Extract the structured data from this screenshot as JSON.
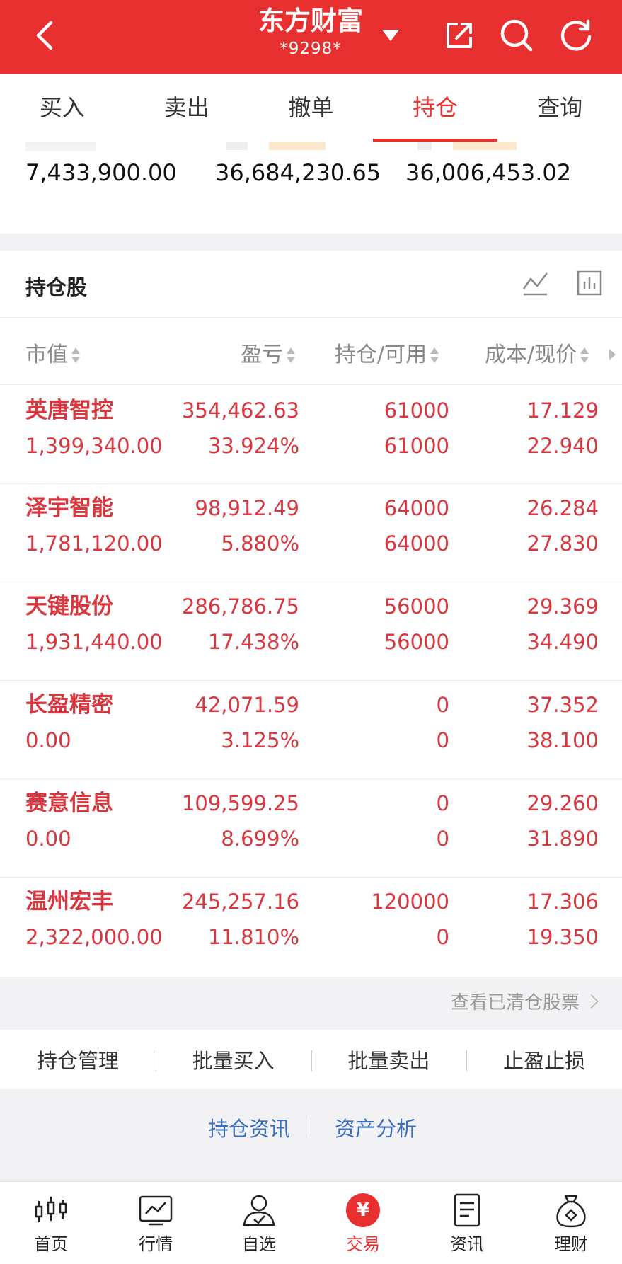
{
  "header": {
    "title": "东方财富",
    "account": "*9298*",
    "colors": {
      "primary": "#e93030",
      "profit": "#d9363e",
      "link": "#3a6ec0"
    }
  },
  "tabs": [
    {
      "label": "买入",
      "active": false
    },
    {
      "label": "卖出",
      "active": false
    },
    {
      "label": "撤单",
      "active": false
    },
    {
      "label": "持仓",
      "active": true
    },
    {
      "label": "查询",
      "active": false
    }
  ],
  "summary": {
    "values": [
      "7,433,900.00",
      "36,684,230.65",
      "36,006,453.02"
    ]
  },
  "holdings": {
    "title": "持仓股",
    "columns": [
      "市值",
      "盈亏",
      "持仓/可用",
      "成本/现价"
    ],
    "rows": [
      {
        "name": "英唐智控",
        "market_value": "1,399,340.00",
        "pnl": "354,462.63",
        "pnl_pct": "33.924%",
        "position": "61000",
        "available": "61000",
        "cost": "17.129",
        "price": "22.940"
      },
      {
        "name": "泽宇智能",
        "market_value": "1,781,120.00",
        "pnl": "98,912.49",
        "pnl_pct": "5.880%",
        "position": "64000",
        "available": "64000",
        "cost": "26.284",
        "price": "27.830"
      },
      {
        "name": "天键股份",
        "market_value": "1,931,440.00",
        "pnl": "286,786.75",
        "pnl_pct": "17.438%",
        "position": "56000",
        "available": "56000",
        "cost": "29.369",
        "price": "34.490"
      },
      {
        "name": "长盈精密",
        "market_value": "0.00",
        "pnl": "42,071.59",
        "pnl_pct": "3.125%",
        "position": "0",
        "available": "0",
        "cost": "37.352",
        "price": "38.100"
      },
      {
        "name": "赛意信息",
        "market_value": "0.00",
        "pnl": "109,599.25",
        "pnl_pct": "8.699%",
        "position": "0",
        "available": "0",
        "cost": "29.260",
        "price": "31.890"
      },
      {
        "name": "温州宏丰",
        "market_value": "2,322,000.00",
        "pnl": "245,257.16",
        "pnl_pct": "11.810%",
        "position": "120000",
        "available": "0",
        "cost": "17.306",
        "price": "19.350"
      }
    ],
    "view_cleared": "查看已清仓股票"
  },
  "actions": [
    "持仓管理",
    "批量买入",
    "批量卖出",
    "止盈止损"
  ],
  "info_links": [
    "持仓资讯",
    "资产分析"
  ],
  "bottom_nav": [
    {
      "label": "首页",
      "icon": "candlestick-icon"
    },
    {
      "label": "行情",
      "icon": "chart-icon"
    },
    {
      "label": "自选",
      "icon": "person-icon"
    },
    {
      "label": "交易",
      "icon": "yuan-icon",
      "active": true,
      "badge": "¥"
    },
    {
      "label": "资讯",
      "icon": "document-icon"
    },
    {
      "label": "理财",
      "icon": "moneybag-icon"
    }
  ]
}
